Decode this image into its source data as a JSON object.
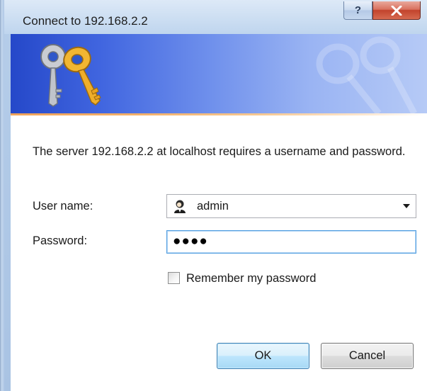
{
  "window": {
    "title": "Connect to 192.168.2.2",
    "help_glyph": "?",
    "close_icon": "close-x-icon"
  },
  "banner": {
    "icon": "keys-icon",
    "accent_colors": [
      "#2548c9",
      "#b6caf6",
      "#f0a35a"
    ]
  },
  "message": "The server 192.168.2.2 at localhost requires a username and password.",
  "form": {
    "username_label": "User name:",
    "username_value": "admin",
    "username_icon": "user-icon",
    "password_label": "Password:",
    "password_mask": "●●●●",
    "remember_label": "Remember my password",
    "remember_checked": false
  },
  "buttons": {
    "ok": "OK",
    "cancel": "Cancel"
  }
}
